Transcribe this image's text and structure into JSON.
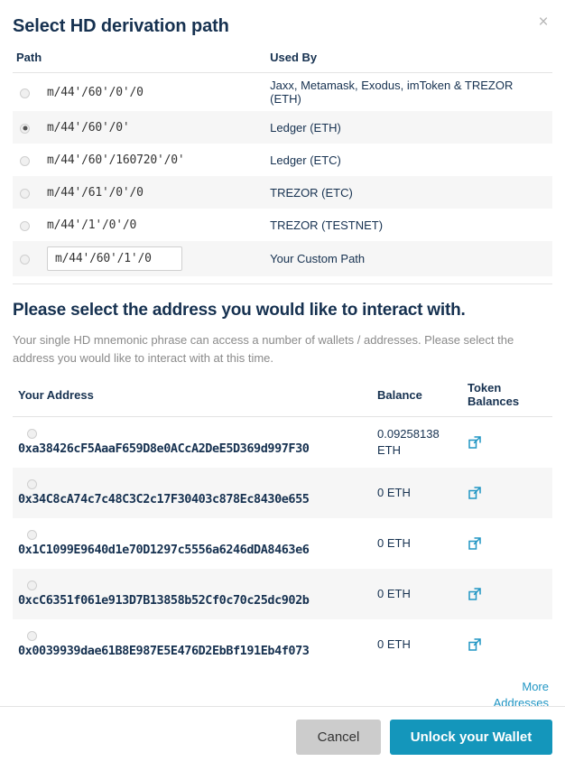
{
  "modal": {
    "title": "Select HD derivation path",
    "close_label": "×"
  },
  "path_table": {
    "headers": {
      "path": "Path",
      "used_by": "Used By"
    },
    "rows": [
      {
        "path": "m/44'/60'/0'/0",
        "used_by": "Jaxx, Metamask, Exodus, imToken & TREZOR (ETH)",
        "selected": false,
        "custom": false
      },
      {
        "path": "m/44'/60'/0'",
        "used_by": "Ledger (ETH)",
        "selected": true,
        "custom": false
      },
      {
        "path": "m/44'/60'/160720'/0'",
        "used_by": "Ledger (ETC)",
        "selected": false,
        "custom": false
      },
      {
        "path": "m/44'/61'/0'/0",
        "used_by": "TREZOR (ETC)",
        "selected": false,
        "custom": false
      },
      {
        "path": "m/44'/1'/0'/0",
        "used_by": "TREZOR (TESTNET)",
        "selected": false,
        "custom": false
      },
      {
        "path": "m/44'/60'/1'/0",
        "used_by": "Your Custom Path",
        "selected": false,
        "custom": true
      }
    ]
  },
  "address_section": {
    "title": "Please select the address you would like to interact with.",
    "description": "Your single HD mnemonic phrase can access a number of wallets / addresses. Please select the address you would like to interact with at this time.",
    "headers": {
      "address": "Your Address",
      "balance": "Balance",
      "token": "Token Balances"
    },
    "rows": [
      {
        "address": "0xa38426cF5AaaF659D8e0ACcA2DeE5D369d997F30",
        "balance": "0.09258138",
        "unit": "ETH",
        "token_icon": "external-link-icon"
      },
      {
        "address": "0x34C8cA74c7c48C3C2c17F30403c878Ec8430e655",
        "balance": "0",
        "unit": "ETH",
        "token_icon": "external-link-icon"
      },
      {
        "address": "0x1C1099E9640d1e70D1297c5556a6246dDA8463e6",
        "balance": "0",
        "unit": "ETH",
        "token_icon": "external-link-icon"
      },
      {
        "address": "0xcC6351f061e913D7B13858b52Cf0c70c25dc902b",
        "balance": "0",
        "unit": "ETH",
        "token_icon": "external-link-icon"
      },
      {
        "address": "0x0039939dae61B8E987E5E476D2EbBf191Eb4f073",
        "balance": "0",
        "unit": "ETH",
        "token_icon": "external-link-icon"
      }
    ],
    "more_addresses_label": "More Addresses"
  },
  "footer": {
    "cancel_label": "Cancel",
    "unlock_label": "Unlock your Wallet"
  },
  "colors": {
    "accent": "#1496bb",
    "link": "#2196c4",
    "text": "#163150",
    "muted": "#8a8a8a",
    "stripe": "#f6f6f6",
    "cancel_bg": "#cccccc"
  }
}
